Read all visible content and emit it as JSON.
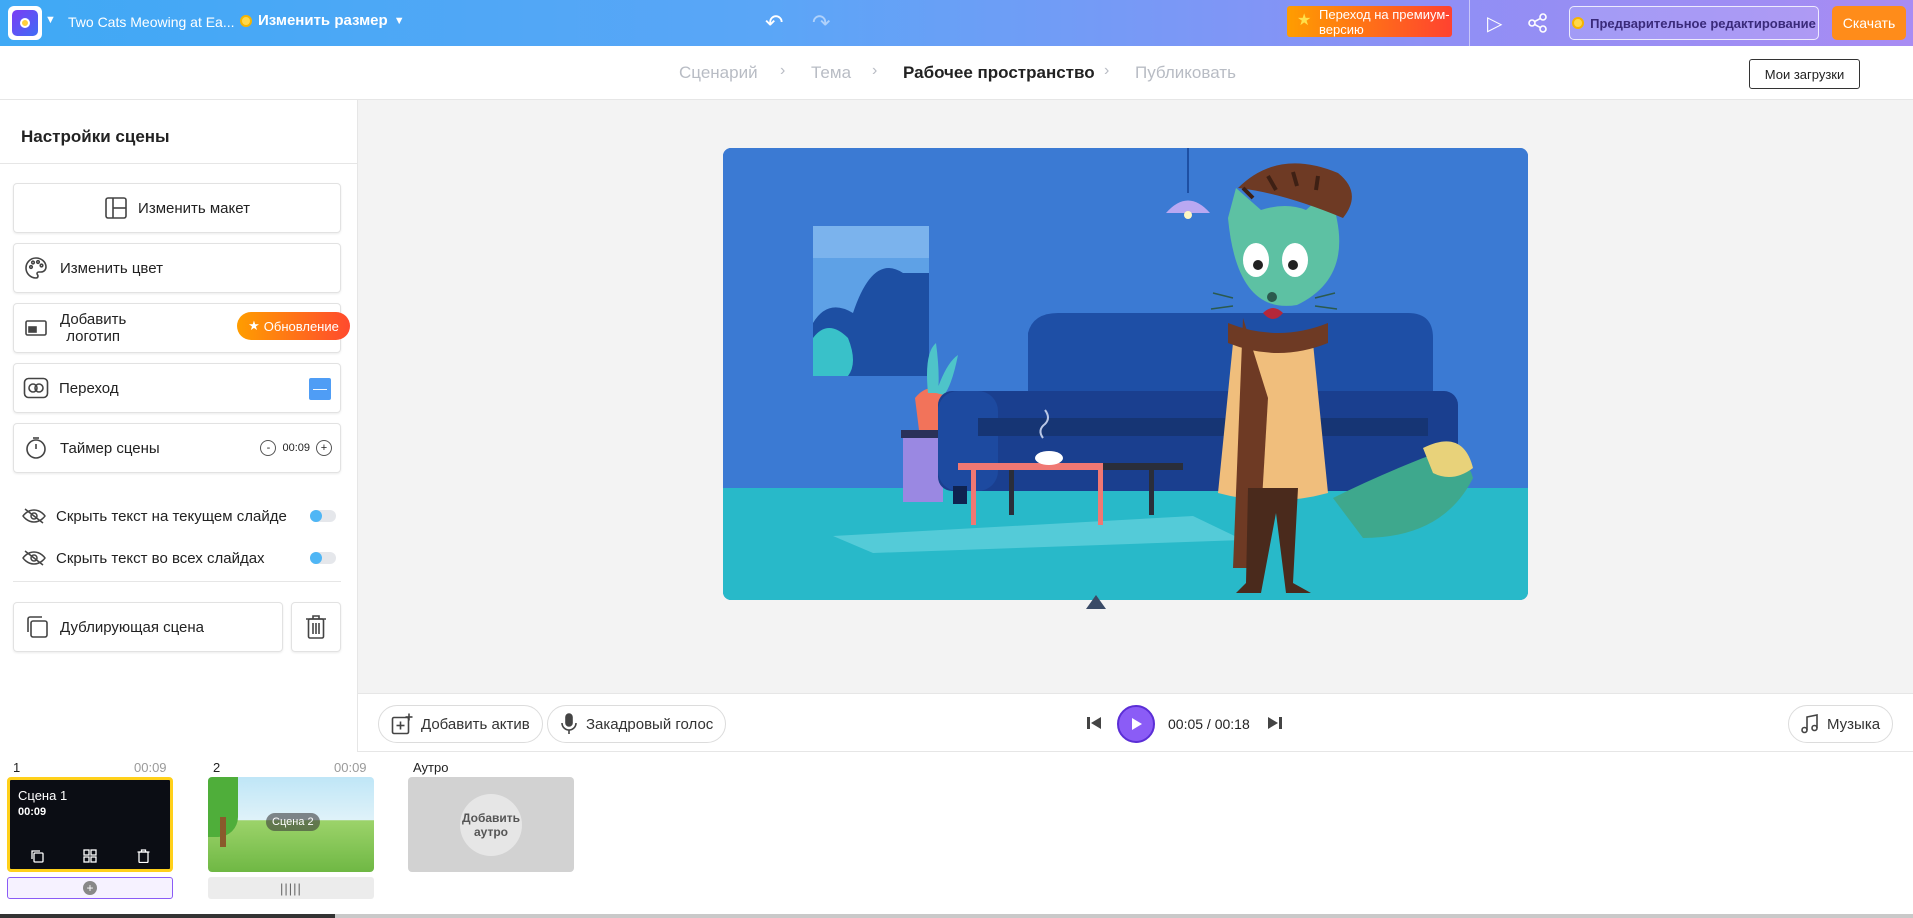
{
  "topbar": {
    "project_title": "Two Cats Meowing at Ea...",
    "resize_label": "Изменить размер",
    "premium_label": "Переход на премиум-версию",
    "pre_edit_label": "Предварительное редактирование",
    "download_label": "Скачать"
  },
  "stepper": {
    "steps": [
      "Сценарий",
      "Тема",
      "Рабочее пространство",
      "Публиковать"
    ],
    "active_step": "Рабочее пространство",
    "my_downloads_label": "Мои загрузки"
  },
  "scene_settings": {
    "title": "Настройки сцены",
    "change_layout": "Изменить макет",
    "change_color": "Изменить цвет",
    "add_logo_line1": "Добавить",
    "add_logo_line2": "логотип",
    "upgrade_badge": "Обновление",
    "transition": "Переход",
    "scene_timer": "Таймер сцены",
    "timer_value": "00:09",
    "hide_text_current": "Скрыть текст на текущем слайде",
    "hide_text_all": "Скрыть текст во всех слайдах",
    "duplicate_scene": "Дублирующая сцена"
  },
  "playbar": {
    "add_asset": "Добавить актив",
    "voiceover": "Закадровый голос",
    "time_readout": "00:05 / 00:18",
    "music": "Музыка"
  },
  "timeline": {
    "scenes": [
      {
        "number": "1",
        "duration": "00:09",
        "thumb_title": "Сцена 1",
        "thumb_time": "00:09"
      },
      {
        "number": "2",
        "duration": "00:09",
        "thumb_label": "Сцена 2"
      }
    ],
    "outro_label": "Аутро",
    "add_outro": "Добавить аутро"
  },
  "colors": {
    "accent_purple": "#8b5cf6",
    "download_orange": "#ff8c1a",
    "selected_scene_border": "#ffd01a",
    "toggle_blue": "#4fb6f5"
  }
}
